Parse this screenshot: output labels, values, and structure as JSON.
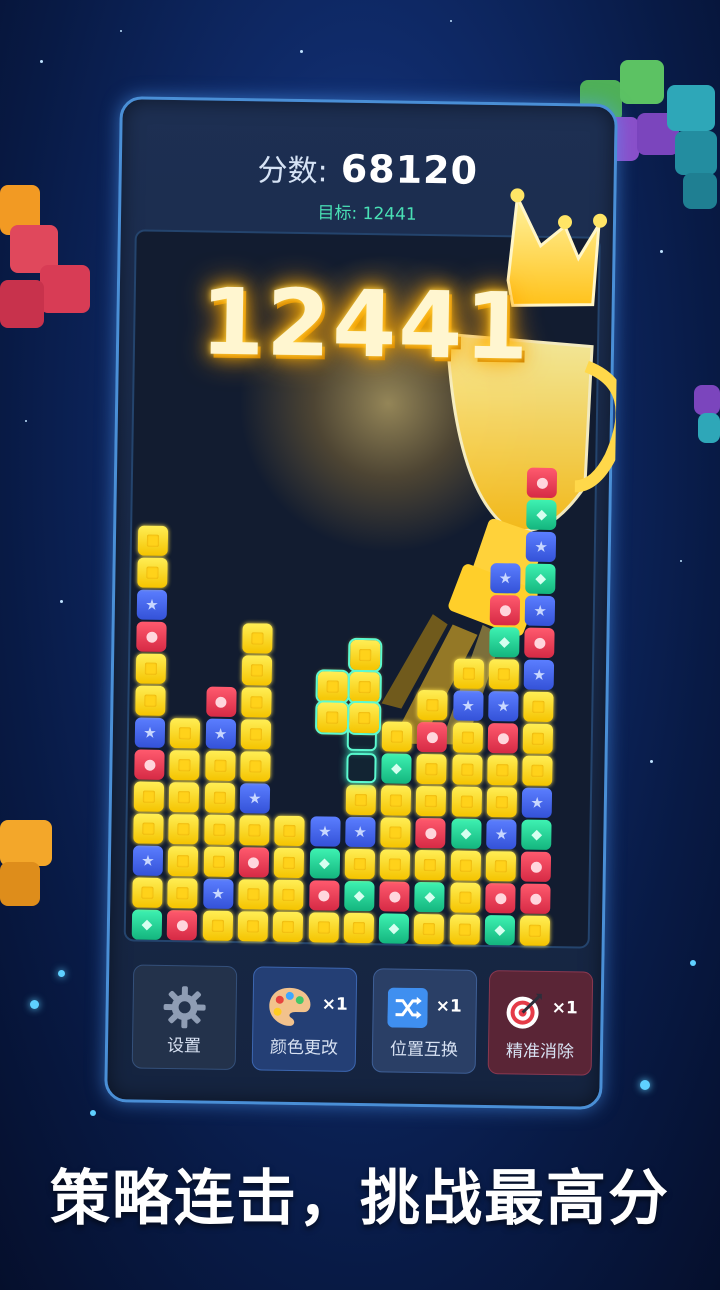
{
  "header": {
    "score_label": "分数:",
    "score_value": "68120",
    "target_text": "目标: 12441"
  },
  "celebration": {
    "big_number": "12441"
  },
  "toolbar": {
    "settings_label": "设置",
    "color_change_label": "颜色更改",
    "color_change_count": "×1",
    "position_swap_label": "位置互换",
    "position_swap_count": "×1",
    "precise_clear_label": "精准消除",
    "precise_clear_count": "×1"
  },
  "slogan": "策略连击，挑战最高分",
  "colors": {
    "background": "#0f2a68",
    "panel_border": "#4a8fd6",
    "target_text": "#49e0b5",
    "yellow_block": "#ffd21a",
    "red_block": "#e63a52",
    "blue_block": "#4466ee",
    "teal_block": "#22d29a"
  },
  "icons": [
    "gear-icon",
    "palette-icon",
    "shuffle-icon",
    "target-icon",
    "trophy-icon",
    "star-icon",
    "diamond-icon"
  ]
}
